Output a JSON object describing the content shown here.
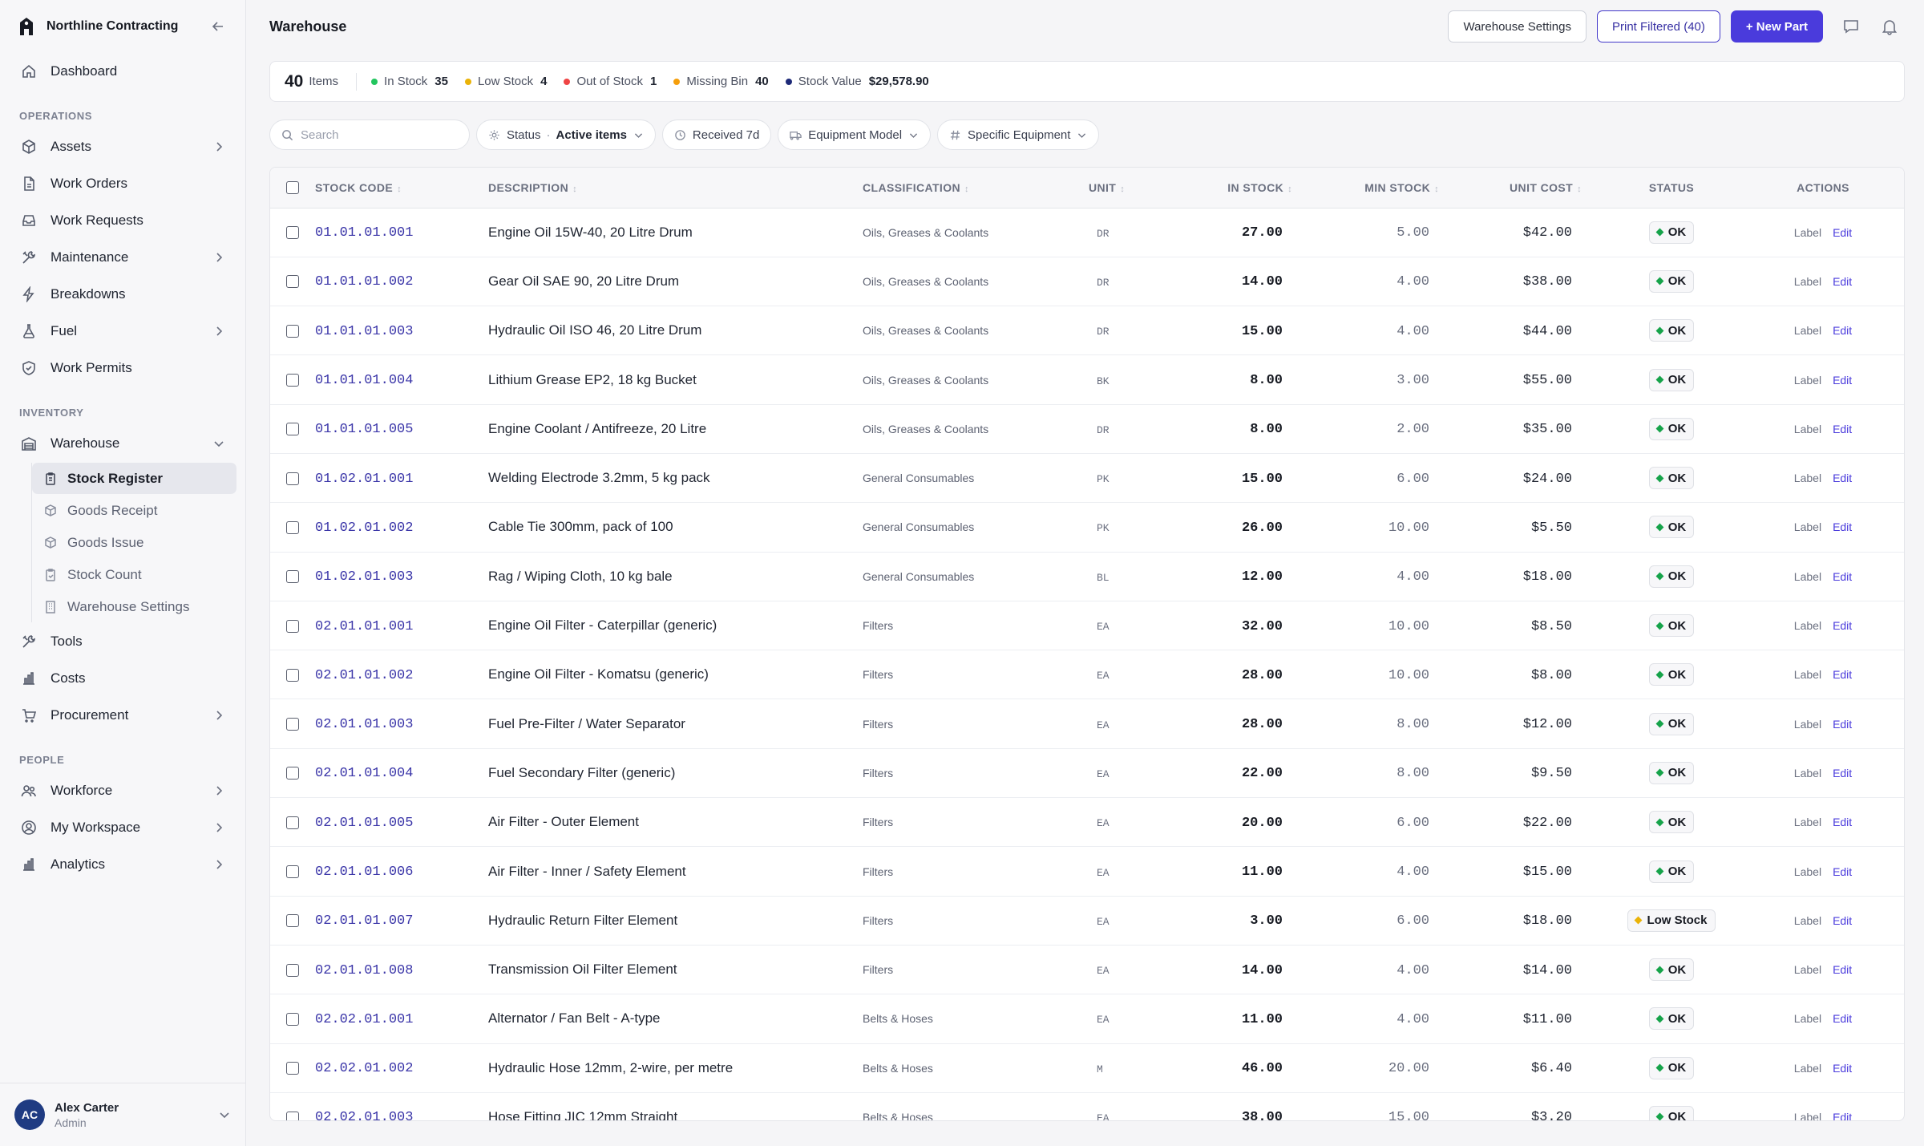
{
  "brand": {
    "name": "Northline Contracting"
  },
  "nav": {
    "dashboard": "Dashboard",
    "operations_label": "OPERATIONS",
    "assets": "Assets",
    "work_orders": "Work Orders",
    "work_requests": "Work Requests",
    "maintenance": "Maintenance",
    "breakdowns": "Breakdowns",
    "fuel": "Fuel",
    "work_permits": "Work Permits",
    "inventory_label": "INVENTORY",
    "warehouse": "Warehouse",
    "warehouse_sub": [
      "Stock Register",
      "Goods Receipt",
      "Goods Issue",
      "Stock Count",
      "Warehouse Settings"
    ],
    "tools": "Tools",
    "costs": "Costs",
    "procurement": "Procurement",
    "people_label": "PEOPLE",
    "workforce": "Workforce",
    "my_workspace": "My Workspace",
    "analytics": "Analytics"
  },
  "user": {
    "initials": "AC",
    "name": "Alex Carter",
    "role": "Admin"
  },
  "header": {
    "title": "Warehouse",
    "settings_btn": "Warehouse Settings",
    "print_btn": "Print Filtered (40)",
    "new_btn": "+ New Part"
  },
  "summary": {
    "count": "40",
    "count_label": "Items",
    "stats": [
      {
        "label": "In Stock",
        "value": "35",
        "color": "#22c55e"
      },
      {
        "label": "Low Stock",
        "value": "4",
        "color": "#eab308"
      },
      {
        "label": "Out of Stock",
        "value": "1",
        "color": "#ef4444"
      },
      {
        "label": "Missing Bin",
        "value": "40",
        "color": "#f59e0b"
      },
      {
        "label": "Stock Value",
        "value": "$29,578.90",
        "color": "#1e2a78"
      }
    ]
  },
  "filters": {
    "search_placeholder": "Search",
    "status_label": "Status",
    "status_dot": "·",
    "status_value": "Active items",
    "received": "Received 7d",
    "equipment_model": "Equipment Model",
    "specific_equipment": "Specific Equipment"
  },
  "table": {
    "columns": {
      "stock_code": "STOCK CODE",
      "description": "DESCRIPTION",
      "classification": "CLASSIFICATION",
      "unit": "UNIT",
      "in_stock": "IN STOCK",
      "min_stock": "MIN STOCK",
      "unit_cost": "UNIT COST",
      "status": "STATUS",
      "actions": "ACTIONS"
    },
    "action_label": "Label",
    "action_edit": "Edit",
    "status_colors": {
      "OK": "#16a34a",
      "Low Stock": "#eab308"
    },
    "rows": [
      {
        "code": "01.01.01.001",
        "desc": "Engine Oil 15W-40, 20 Litre Drum",
        "cls": "Oils, Greases & Coolants",
        "unit": "DR",
        "in": "27.00",
        "min": "5.00",
        "cost": "$42.00",
        "status": "OK"
      },
      {
        "code": "01.01.01.002",
        "desc": "Gear Oil SAE 90, 20 Litre Drum",
        "cls": "Oils, Greases & Coolants",
        "unit": "DR",
        "in": "14.00",
        "min": "4.00",
        "cost": "$38.00",
        "status": "OK"
      },
      {
        "code": "01.01.01.003",
        "desc": "Hydraulic Oil ISO 46, 20 Litre Drum",
        "cls": "Oils, Greases & Coolants",
        "unit": "DR",
        "in": "15.00",
        "min": "4.00",
        "cost": "$44.00",
        "status": "OK"
      },
      {
        "code": "01.01.01.004",
        "desc": "Lithium Grease EP2, 18 kg Bucket",
        "cls": "Oils, Greases & Coolants",
        "unit": "BK",
        "in": "8.00",
        "min": "3.00",
        "cost": "$55.00",
        "status": "OK"
      },
      {
        "code": "01.01.01.005",
        "desc": "Engine Coolant / Antifreeze, 20 Litre",
        "cls": "Oils, Greases & Coolants",
        "unit": "DR",
        "in": "8.00",
        "min": "2.00",
        "cost": "$35.00",
        "status": "OK"
      },
      {
        "code": "01.02.01.001",
        "desc": "Welding Electrode 3.2mm, 5 kg pack",
        "cls": "General Consumables",
        "unit": "PK",
        "in": "15.00",
        "min": "6.00",
        "cost": "$24.00",
        "status": "OK"
      },
      {
        "code": "01.02.01.002",
        "desc": "Cable Tie 300mm, pack of 100",
        "cls": "General Consumables",
        "unit": "PK",
        "in": "26.00",
        "min": "10.00",
        "cost": "$5.50",
        "status": "OK"
      },
      {
        "code": "01.02.01.003",
        "desc": "Rag / Wiping Cloth, 10 kg bale",
        "cls": "General Consumables",
        "unit": "BL",
        "in": "12.00",
        "min": "4.00",
        "cost": "$18.00",
        "status": "OK"
      },
      {
        "code": "02.01.01.001",
        "desc": "Engine Oil Filter - Caterpillar (generic)",
        "cls": "Filters",
        "unit": "EA",
        "in": "32.00",
        "min": "10.00",
        "cost": "$8.50",
        "status": "OK"
      },
      {
        "code": "02.01.01.002",
        "desc": "Engine Oil Filter - Komatsu (generic)",
        "cls": "Filters",
        "unit": "EA",
        "in": "28.00",
        "min": "10.00",
        "cost": "$8.00",
        "status": "OK"
      },
      {
        "code": "02.01.01.003",
        "desc": "Fuel Pre-Filter / Water Separator",
        "cls": "Filters",
        "unit": "EA",
        "in": "28.00",
        "min": "8.00",
        "cost": "$12.00",
        "status": "OK"
      },
      {
        "code": "02.01.01.004",
        "desc": "Fuel Secondary Filter (generic)",
        "cls": "Filters",
        "unit": "EA",
        "in": "22.00",
        "min": "8.00",
        "cost": "$9.50",
        "status": "OK"
      },
      {
        "code": "02.01.01.005",
        "desc": "Air Filter - Outer Element",
        "cls": "Filters",
        "unit": "EA",
        "in": "20.00",
        "min": "6.00",
        "cost": "$22.00",
        "status": "OK"
      },
      {
        "code": "02.01.01.006",
        "desc": "Air Filter - Inner / Safety Element",
        "cls": "Filters",
        "unit": "EA",
        "in": "11.00",
        "min": "4.00",
        "cost": "$15.00",
        "status": "OK"
      },
      {
        "code": "02.01.01.007",
        "desc": "Hydraulic Return Filter Element",
        "cls": "Filters",
        "unit": "EA",
        "in": "3.00",
        "min": "6.00",
        "cost": "$18.00",
        "status": "Low Stock"
      },
      {
        "code": "02.01.01.008",
        "desc": "Transmission Oil Filter Element",
        "cls": "Filters",
        "unit": "EA",
        "in": "14.00",
        "min": "4.00",
        "cost": "$14.00",
        "status": "OK"
      },
      {
        "code": "02.02.01.001",
        "desc": "Alternator / Fan Belt - A-type",
        "cls": "Belts & Hoses",
        "unit": "EA",
        "in": "11.00",
        "min": "4.00",
        "cost": "$11.00",
        "status": "OK"
      },
      {
        "code": "02.02.01.002",
        "desc": "Hydraulic Hose 12mm, 2-wire, per metre",
        "cls": "Belts & Hoses",
        "unit": "M",
        "in": "46.00",
        "min": "20.00",
        "cost": "$6.40",
        "status": "OK"
      },
      {
        "code": "02.02.01.003",
        "desc": "Hose Fitting JIC 12mm Straight",
        "cls": "Belts & Hoses",
        "unit": "EA",
        "in": "38.00",
        "min": "15.00",
        "cost": "$3.20",
        "status": "OK"
      }
    ]
  }
}
